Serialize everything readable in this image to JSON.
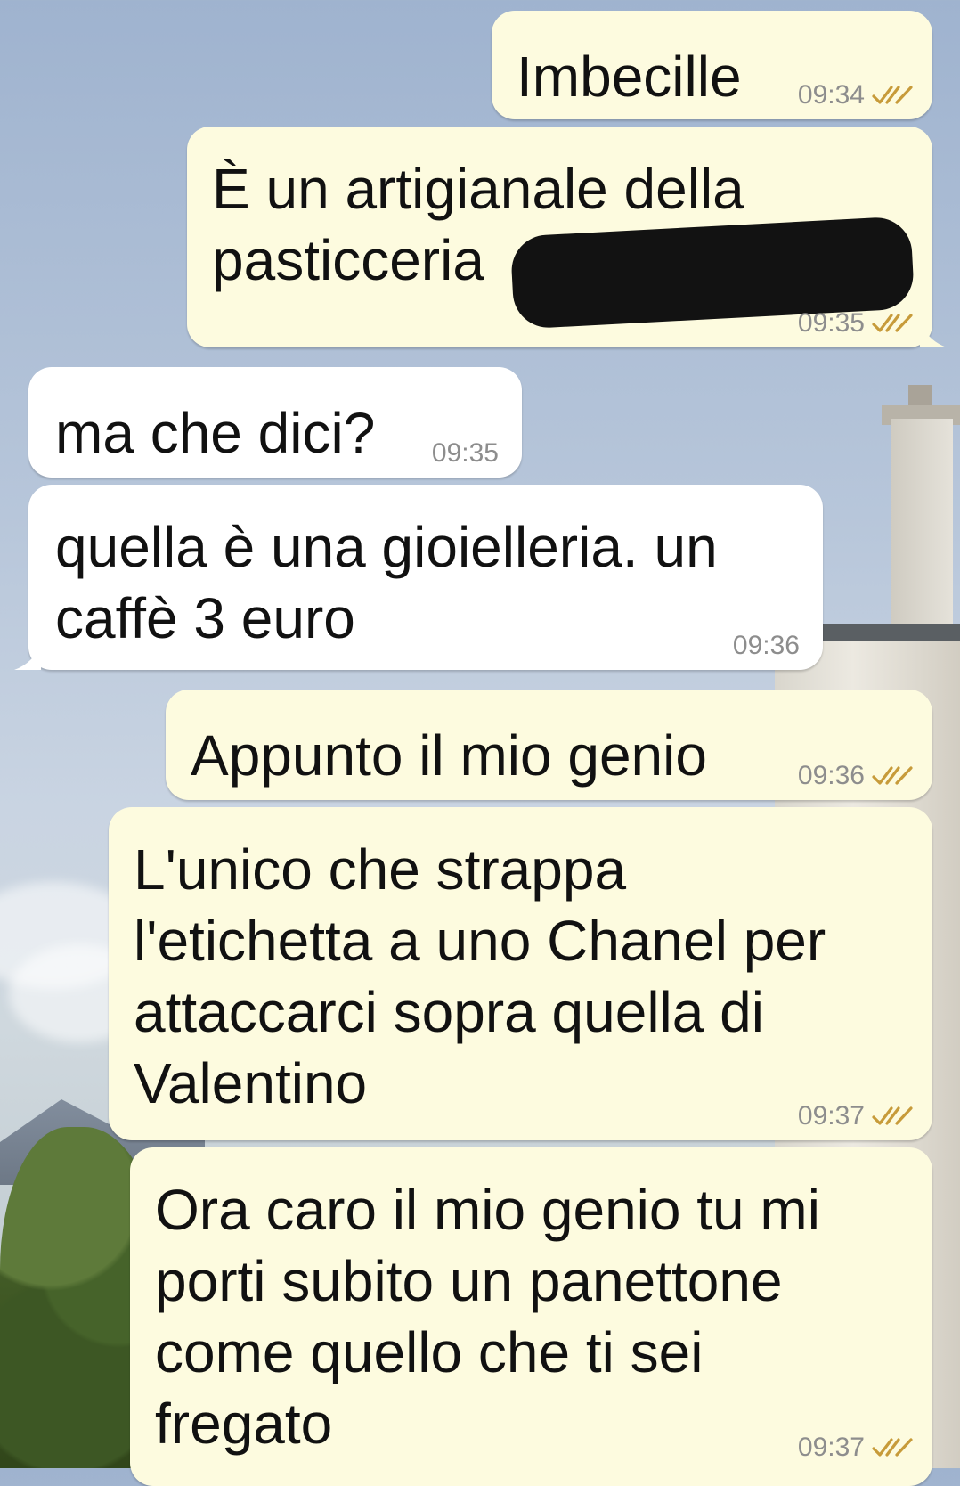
{
  "colors": {
    "outgoing_bubble": "#fdfbdf",
    "incoming_bubble": "#ffffff",
    "timestamp": "#8d8d8d",
    "read_ticks": "#c79b3a",
    "redaction": "#121212"
  },
  "messages": [
    {
      "direction": "outgoing",
      "text": "Imbecille",
      "time": "09:34",
      "status": "read-double-tick"
    },
    {
      "direction": "outgoing",
      "text": "È un artigianale della\npasticceria",
      "time": "09:35",
      "status": "read-double-tick",
      "redacted_trailing_text": true
    },
    {
      "direction": "incoming",
      "text": "ma che dici?",
      "time": "09:35"
    },
    {
      "direction": "incoming",
      "text": "quella è una gioielleria. un\ncaffè 3 euro",
      "time": "09:36"
    },
    {
      "direction": "outgoing",
      "text": "Appunto il mio genio",
      "time": "09:36",
      "status": "read-double-tick"
    },
    {
      "direction": "outgoing",
      "text": "L'unico che strappa\nl'etichetta a uno Chanel per\nattaccarci sopra quella di\nValentino",
      "time": "09:37",
      "status": "read-double-tick"
    },
    {
      "direction": "outgoing",
      "text": "Ora caro il mio genio tu mi\nporti subito un panettone\ncome quello che ti sei\nfregato",
      "time": "09:37",
      "status": "read-double-tick"
    }
  ]
}
